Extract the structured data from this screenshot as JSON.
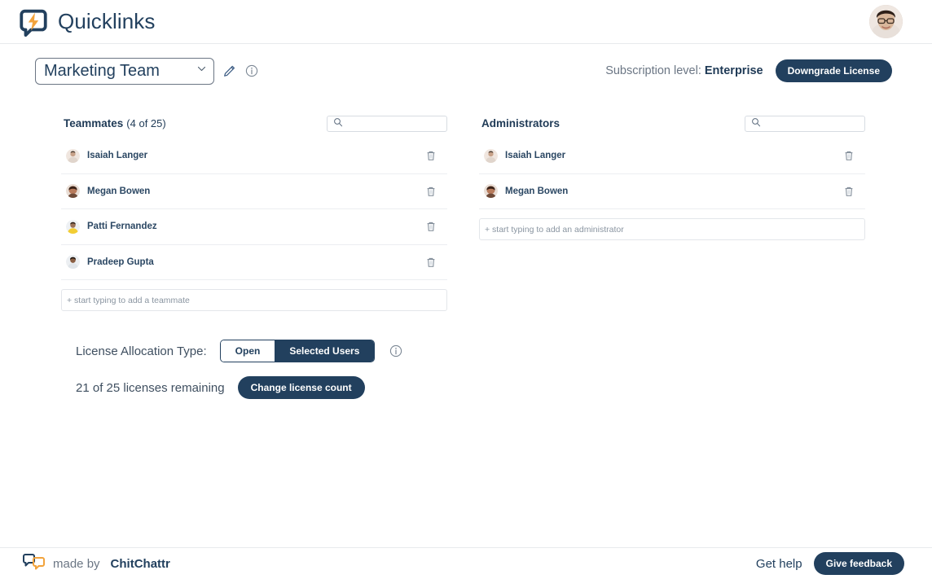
{
  "header": {
    "brand_name": "Quicklinks",
    "logo_icon": "quicklinks-bolt-bubble-icon",
    "avatar_icon": "user-avatar"
  },
  "subheader": {
    "team_selected": "Marketing Team",
    "dropdown_icon": "chevron-down-icon",
    "edit_icon": "pencil-icon",
    "info_icon": "info-circle-icon",
    "subscription_prefix": "Subscription level:",
    "subscription_level": "Enterprise",
    "downgrade_label": "Downgrade License"
  },
  "teammates": {
    "title": "Teammates",
    "count_label": "(4 of 25)",
    "search_placeholder": "",
    "search_value": "",
    "search_icon": "search-icon",
    "members": [
      {
        "name": "Isaiah Langer",
        "avatar": "#d8c3b4",
        "delete_icon": "trash-icon"
      },
      {
        "name": "Megan Bowen",
        "avatar": "#8a5b45",
        "delete_icon": "trash-icon"
      },
      {
        "name": "Patti Fernandez",
        "avatar": "#e8c63a",
        "delete_icon": "trash-icon"
      },
      {
        "name": "Pradeep Gupta",
        "avatar": "#3b2a20",
        "delete_icon": "trash-icon"
      }
    ],
    "add_placeholder": "+ start typing to add a teammate",
    "add_value": ""
  },
  "administrators": {
    "title": "Administrators",
    "search_placeholder": "",
    "search_value": "",
    "search_icon": "search-icon",
    "members": [
      {
        "name": "Isaiah Langer",
        "avatar": "#d8c3b4",
        "delete_icon": "trash-icon"
      },
      {
        "name": "Megan Bowen",
        "avatar": "#8a5b45",
        "delete_icon": "trash-icon"
      }
    ],
    "add_placeholder": "+ start typing to add an administrator",
    "add_value": ""
  },
  "license": {
    "allocation_label": "License Allocation Type:",
    "option_open": "Open",
    "option_selected_users": "Selected Users",
    "selected_option": "Selected Users",
    "info_icon": "info-circle-icon",
    "remaining_text": "21 of 25 licenses remaining",
    "change_count_label": "Change license count"
  },
  "footer": {
    "logo_icon": "chitchattr-bubbles-icon",
    "made_by": "made by",
    "brand": "ChitChattr",
    "get_help": "Get help",
    "feedback_label": "Give feedback"
  },
  "colors": {
    "navy": "#22405e",
    "orange": "#f2a33c",
    "muted": "#6b7684",
    "border": "#e3e6ea"
  }
}
